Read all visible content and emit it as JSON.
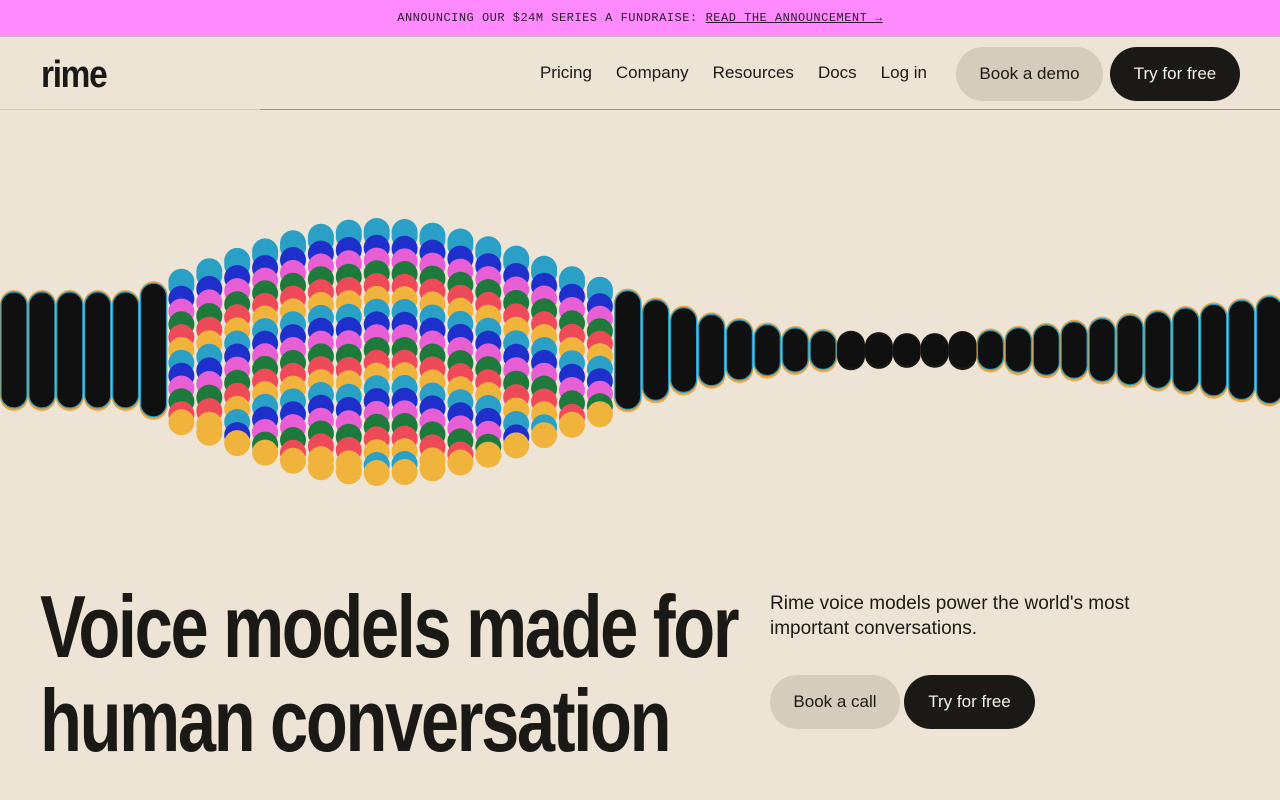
{
  "banner": {
    "prefix": "ANNOUNCING OUR $24M SERIES A FUNDRAISE:",
    "link": "READ THE ANNOUNCEMENT →"
  },
  "nav": {
    "logo": "rime",
    "links": [
      "Pricing",
      "Company",
      "Resources",
      "Docs",
      "Log in"
    ],
    "book_demo": "Book a demo",
    "try_free": "Try for free"
  },
  "hero": {
    "title_line1": "Voice models made for",
    "title_line2": "human conversation",
    "subtitle": "Rime voice models power the world's most important conversations.",
    "book_call": "Book a call",
    "try_free": "Try for free"
  },
  "colors": {
    "background": "#ede4d6",
    "banner": "#ff8aff",
    "dark": "#1b1915",
    "light_button": "#d6ccbc",
    "wave_colors": [
      "#2aa0c6",
      "#1f2fcc",
      "#e85fd5",
      "#1e7a3a",
      "#ef4a57",
      "#f0b43c"
    ]
  }
}
